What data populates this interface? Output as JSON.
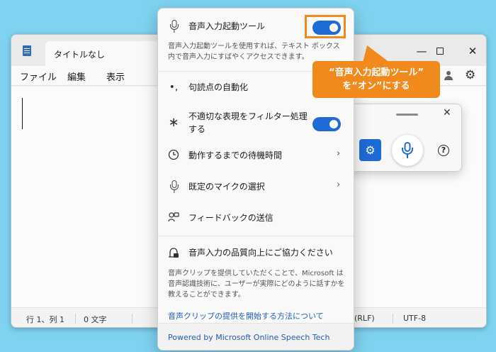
{
  "notepad": {
    "tab_title": "タイトルなし",
    "min_glyph": "—",
    "close_glyph": "✕",
    "menu": [
      "ファイル",
      "編集",
      "表示"
    ],
    "settings_glyph": "⚙",
    "status": {
      "position": "行 1、列 1",
      "chars": "0 文字",
      "line_ending": "(RLF)",
      "encoding": "UTF-8"
    }
  },
  "voice_toolbar": {
    "close_glyph": "✕",
    "settings_glyph": "⚙",
    "help_glyph": "?"
  },
  "flyout": {
    "launcher": {
      "label": "音声入力起動ツール",
      "description": "音声入力起動ツールを使用すれば、テキスト ボックス内で音声入力にすばやくアクセスできます。",
      "enabled": true
    },
    "auto_punctuation": {
      "label": "句読点の自動化",
      "icon_glyph": "•,"
    },
    "profanity_filter": {
      "label": "不適切な表現をフィルター処理する",
      "icon_glyph": "∗",
      "enabled": true
    },
    "wait_time": {
      "label": "動作するまでの待機時間",
      "chevron": "›"
    },
    "default_mic": {
      "label": "既定のマイクの選択",
      "chevron": "›"
    },
    "feedback": {
      "label": "フィードバックの送信"
    },
    "quality": {
      "label": "音声入力の品質向上にご協力ください",
      "description": "音声クリップを提供していただくことで、Microsoft は音声認識技術に、ユーザーが実際にどのように話すかを教えることができます。",
      "link": "音声クリップの提供を開始する方法について"
    },
    "footer_link": "Powered by Microsoft Online Speech Tech"
  },
  "callout": {
    "line1": "“音声入力起動ツール”",
    "line2": "を“オン”にする"
  },
  "colors": {
    "accent": "#1e6bd6",
    "highlight": "#f08a1c",
    "background": "#7fd3f1"
  }
}
